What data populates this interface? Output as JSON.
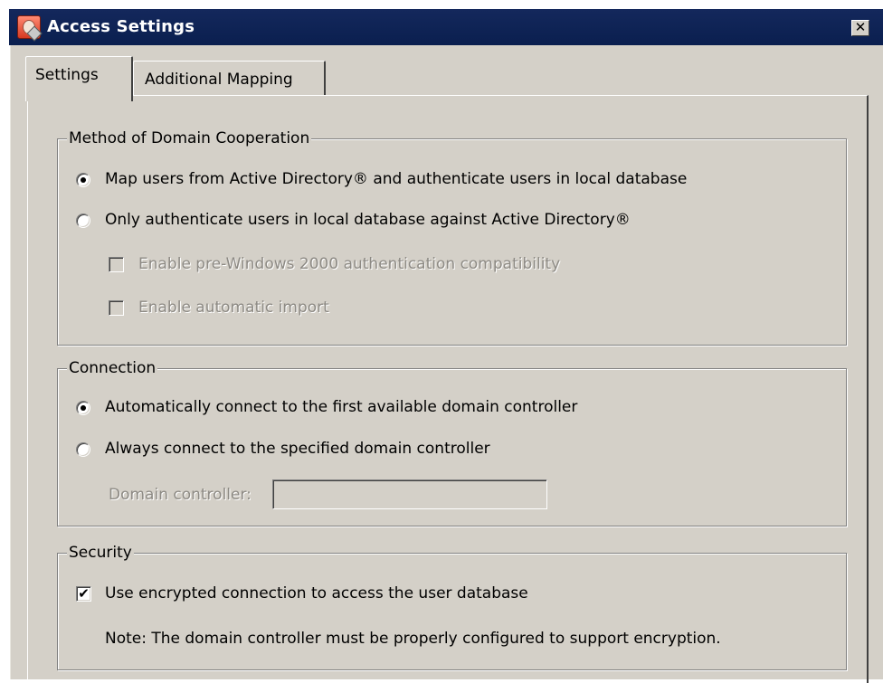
{
  "window": {
    "title": "Access Settings",
    "close_glyph": "✕"
  },
  "tabs": [
    {
      "label": "Settings",
      "selected": true
    },
    {
      "label": "Additional Mapping",
      "selected": false
    }
  ],
  "method_group": {
    "legend": "Method of Domain Cooperation",
    "options": [
      {
        "label": "Map users from Active Directory® and authenticate users in local database",
        "selected": true
      },
      {
        "label": "Only authenticate users in local database against Active Directory®",
        "selected": false
      }
    ],
    "checkboxes": [
      {
        "label": "Enable pre-Windows 2000 authentication compatibility",
        "checked": false,
        "enabled": false
      },
      {
        "label": "Enable automatic import",
        "checked": false,
        "enabled": false
      }
    ]
  },
  "connection_group": {
    "legend": "Connection",
    "options": [
      {
        "label": "Automatically connect to the first available domain controller",
        "selected": true
      },
      {
        "label": "Always connect to the specified domain controller",
        "selected": false
      }
    ],
    "domain_controller_label": "Domain controller:",
    "domain_controller_value": ""
  },
  "security_group": {
    "legend": "Security",
    "checkbox": {
      "label": "Use encrypted connection to access the user database",
      "checked": true,
      "check_glyph": "✔"
    },
    "note": "Note: The domain controller must be properly configured to support encryption."
  },
  "colors": {
    "title_bar": "#0a1f4f",
    "dialog_face": "#d4d0c8",
    "disabled_text": "#8d8a84"
  }
}
